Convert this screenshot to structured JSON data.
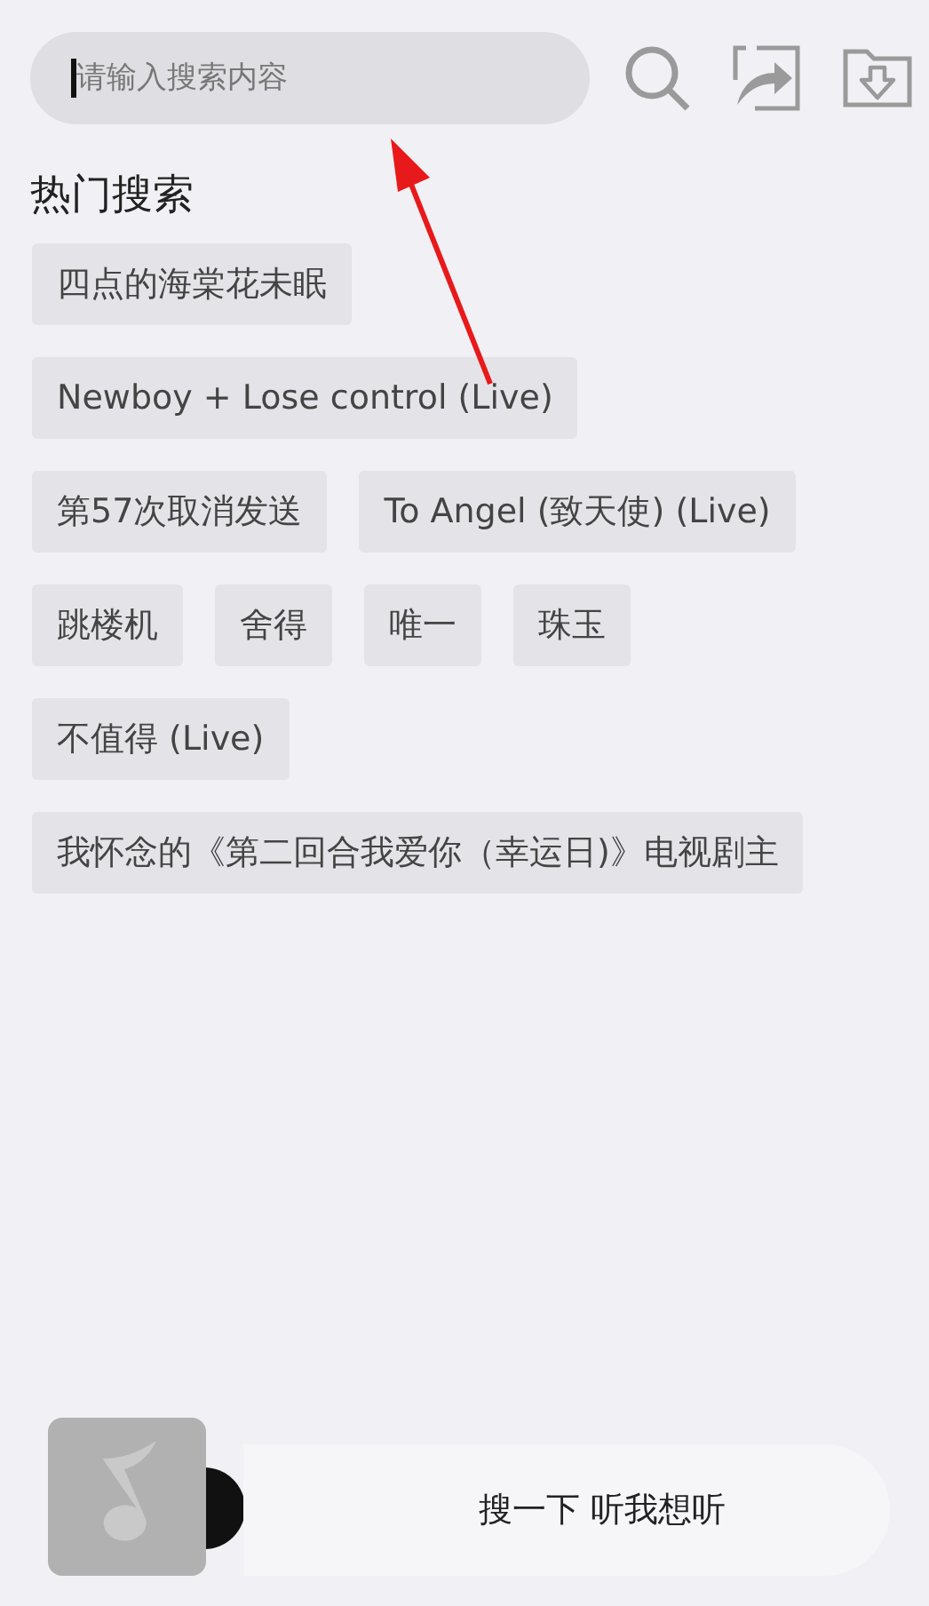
{
  "search": {
    "placeholder": "请输入搜索内容"
  },
  "hot_search": {
    "title": "热门搜索",
    "tag_rows": [
      [
        "四点的海棠花未眠"
      ],
      [
        "Newboy + Lose control (Live)"
      ],
      [
        "第57次取消发送",
        "To Angel (致天使) (Live)"
      ],
      [
        "跳楼机",
        "舍得",
        "唯一",
        "珠玉"
      ],
      [
        "不值得 (Live)"
      ],
      [
        "我怀念的《第二回合我爱你（幸运日)》电视剧主"
      ]
    ]
  },
  "player": {
    "prompt": "搜一下 听我想听"
  }
}
